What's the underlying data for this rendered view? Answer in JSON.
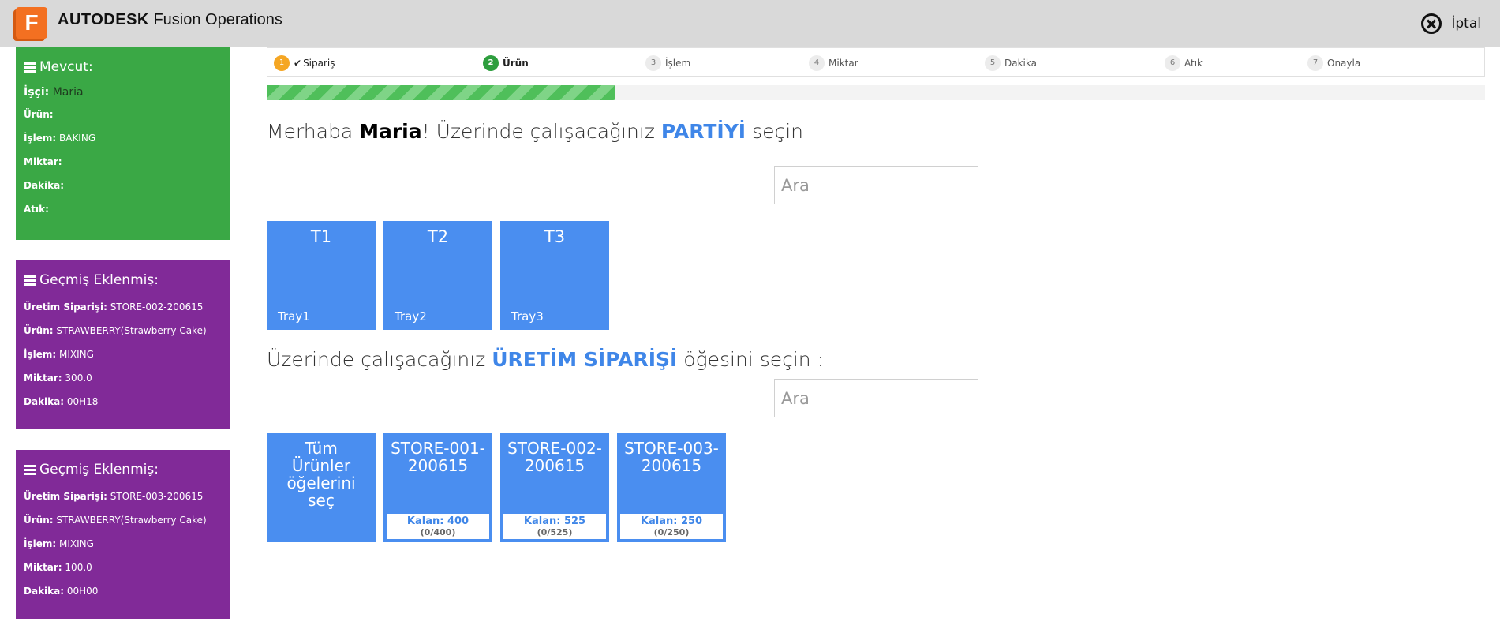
{
  "header": {
    "logo_letter": "F",
    "brand_bold": "AUTODESK",
    "brand_product": "Fusion Operations",
    "cancel_label": "İptal"
  },
  "current": {
    "title": "Mevcut:",
    "worker_label": "İşçi:",
    "worker_value": "Maria",
    "product_label": "Ürün:",
    "product_value": "",
    "operation_label": "İşlem:",
    "operation_value": "BAKING",
    "quantity_label": "Miktar:",
    "quantity_value": "",
    "minutes_label": "Dakika:",
    "minutes_value": "",
    "waste_label": "Atık:",
    "waste_value": ""
  },
  "history": [
    {
      "title": "Geçmiş Eklenmiş:",
      "order_label": "Üretim Siparişi:",
      "order_value": "STORE-002-200615",
      "product_label": "Ürün:",
      "product_value": "STRAWBERRY(Strawberry Cake)",
      "operation_label": "İşlem:",
      "operation_value": "MIXING",
      "quantity_label": "Miktar:",
      "quantity_value": "300.0",
      "minutes_label": "Dakika:",
      "minutes_value": "00H18"
    },
    {
      "title": "Geçmiş Eklenmiş:",
      "order_label": "Üretim Siparişi:",
      "order_value": "STORE-003-200615",
      "product_label": "Ürün:",
      "product_value": "STRAWBERRY(Strawberry Cake)",
      "operation_label": "İşlem:",
      "operation_value": "MIXING",
      "quantity_label": "Miktar:",
      "quantity_value": "100.0",
      "minutes_label": "Dakika:",
      "minutes_value": "00H00"
    }
  ],
  "stepper": {
    "steps": [
      {
        "num": "1",
        "label": "Sipariş",
        "check": "✔"
      },
      {
        "num": "2",
        "label": "Ürün"
      },
      {
        "num": "3",
        "label": "İşlem"
      },
      {
        "num": "4",
        "label": "Miktar"
      },
      {
        "num": "5",
        "label": "Dakika"
      },
      {
        "num": "6",
        "label": "Atık"
      },
      {
        "num": "7",
        "label": "Onayla"
      }
    ],
    "progress_percent": 28.6
  },
  "batch_section": {
    "greeting": "Merhaba ",
    "name": "Maria",
    "text_before": "! Üzerinde çalışacağınız ",
    "accent": "PARTİYİ",
    "text_after": " seçin",
    "search_placeholder": "Ara",
    "tiles": [
      {
        "title": "T1",
        "subtitle": "Tray1"
      },
      {
        "title": "T2",
        "subtitle": "Tray2"
      },
      {
        "title": "T3",
        "subtitle": "Tray3"
      }
    ]
  },
  "order_section": {
    "text_before": "Üzerinde çalışacağınız ",
    "accent": "ÜRETİM SİPARİŞİ",
    "text_after": " öğesini seçin :",
    "search_placeholder": "Ara",
    "all_tile_lines": [
      "Tüm",
      "Ürünler",
      "öğelerini",
      "seç"
    ],
    "orders": [
      {
        "line1": "STORE-001-",
        "line2": "200615",
        "remaining": "Kalan: 400",
        "progress": "(0/400)"
      },
      {
        "line1": "STORE-002-",
        "line2": "200615",
        "remaining": "Kalan: 525",
        "progress": "(0/525)"
      },
      {
        "line1": "STORE-003-",
        "line2": "200615",
        "remaining": "Kalan: 250",
        "progress": "(0/250)"
      }
    ]
  },
  "colors": {
    "accent_blue": "#3f86e8",
    "tile_blue": "#4a8ef0",
    "panel_green": "#3aa845",
    "panel_purple": "#812a98",
    "logo_orange": "#f37021"
  }
}
